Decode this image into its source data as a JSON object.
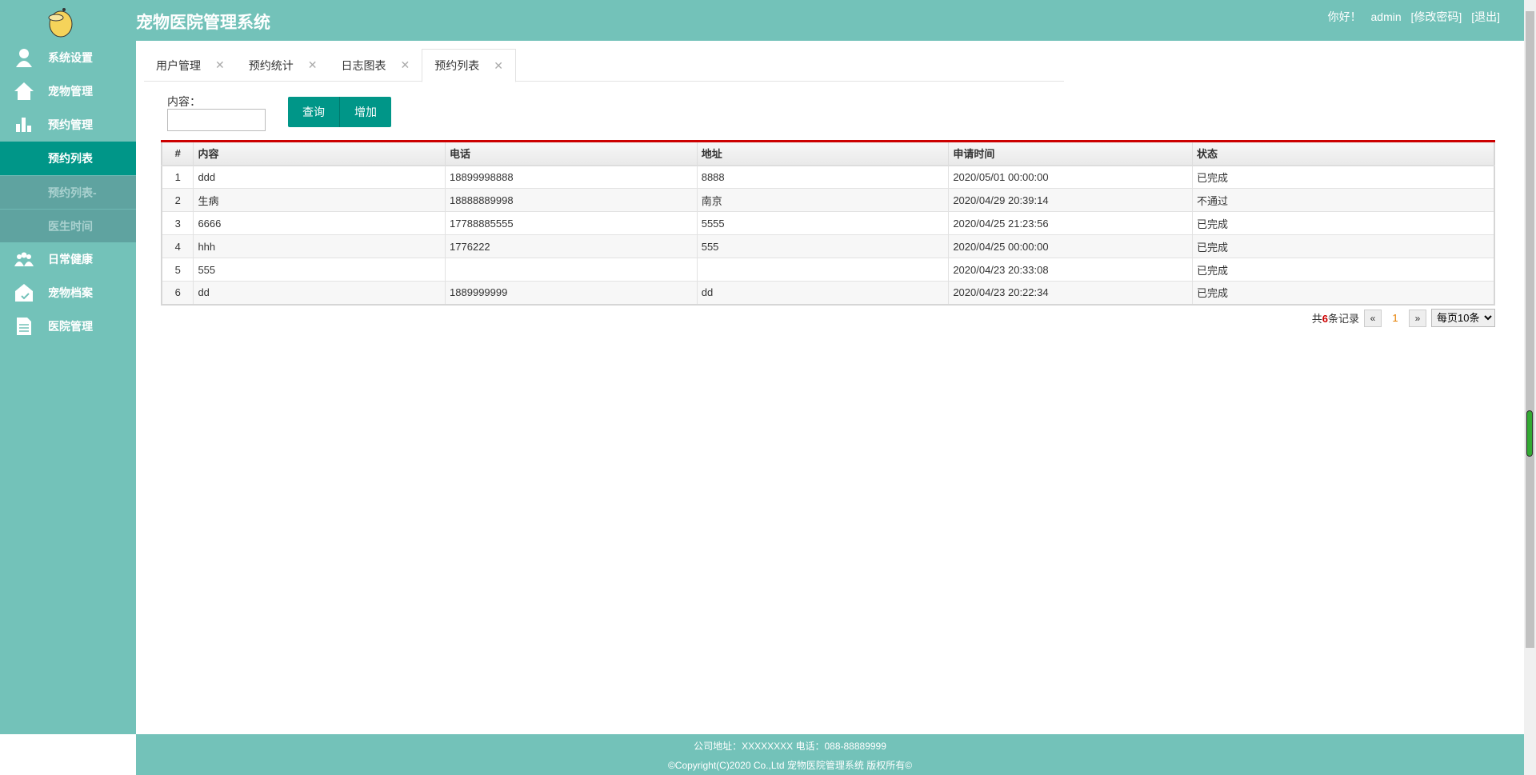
{
  "header": {
    "title": "宠物医院管理系统",
    "greeting": "你好！",
    "user": "admin",
    "change_password": "[修改密码]",
    "logout": "[退出]"
  },
  "sidebar": {
    "items": [
      {
        "label": "系统设置",
        "icon": "user-icon"
      },
      {
        "label": "宠物管理",
        "icon": "home-icon"
      },
      {
        "label": "预约管理",
        "icon": "bar-chart-icon"
      },
      {
        "label": "预约列表",
        "active": true
      },
      {
        "label": "预约列表-",
        "sub": true
      },
      {
        "label": "医生时间",
        "sub": true
      },
      {
        "label": "日常健康",
        "icon": "group-icon"
      },
      {
        "label": "宠物档案",
        "icon": "pet-record-icon"
      },
      {
        "label": "医院管理",
        "icon": "document-icon"
      }
    ]
  },
  "tabs": [
    {
      "label": "用户管理"
    },
    {
      "label": "预约统计"
    },
    {
      "label": "日志图表"
    },
    {
      "label": "预约列表",
      "active": true
    }
  ],
  "search": {
    "label": "内容：",
    "value": "",
    "query_button": "查询",
    "add_button": "增加"
  },
  "table": {
    "headers": [
      "#",
      "内容",
      "电话",
      "地址",
      "申请时间",
      "状态"
    ],
    "rows": [
      [
        "1",
        "ddd",
        "18899998888",
        "8888",
        "2020/05/01 00:00:00",
        "已完成"
      ],
      [
        "2",
        "生病",
        "18888889998",
        "南京",
        "2020/04/29 20:39:14",
        "不通过"
      ],
      [
        "3",
        "6666",
        "17788885555",
        "5555",
        "2020/04/25 21:23:56",
        "已完成"
      ],
      [
        "4",
        "hhh",
        "1776222",
        "555",
        "2020/04/25 00:00:00",
        "已完成"
      ],
      [
        "5",
        "555",
        "",
        "",
        "2020/04/23 20:33:08",
        "已完成"
      ],
      [
        "6",
        "dd",
        "1889999999",
        "dd",
        "2020/04/23 20:22:34",
        "已完成"
      ]
    ]
  },
  "pager": {
    "prefix": "共",
    "count": "6",
    "suffix": "条记录",
    "prev": "«",
    "current": "1",
    "next": "»",
    "page_size": "每页10条"
  },
  "footer": {
    "line1": "公司地址：XXXXXXXX 电话：088-88889999",
    "line2": "©Copyright(C)2020 Co.,Ltd 宠物医院管理系统 版权所有©"
  },
  "colors": {
    "theme": "#73c2b9",
    "accent": "#009688",
    "table_top": "#cc0000"
  }
}
